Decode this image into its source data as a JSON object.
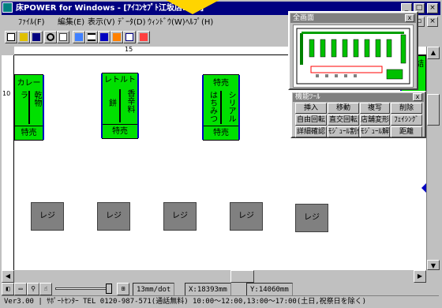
{
  "window": {
    "title": "床POWER for Windows - [ｱｲｺﾝｾﾌﾟﾄ江坂店.FLY]"
  },
  "menu": [
    {
      "label": "ﾌｧｲﾙ(F)"
    },
    {
      "label": "編集(E)"
    },
    {
      "label": "表示(V)"
    },
    {
      "label": "ﾃﾞｰﾀ(D)"
    },
    {
      "label": "ｳｨﾝﾄﾞｳ(W)"
    },
    {
      "label": "ﾍﾙﾌﾟ(H)"
    }
  ],
  "ruler": {
    "top_mark": "15",
    "left_mark": "10"
  },
  "shelves": [
    {
      "top": "カレー",
      "cells": [
        "ラ",
        "乾物"
      ],
      "bottom": "特売"
    },
    {
      "top": "レトルト",
      "cells": [
        "餅",
        "香辛料"
      ],
      "bottom": "特売"
    },
    {
      "top": "特売",
      "cells": [
        "はちみつ",
        "シリアル"
      ],
      "bottom": "特売"
    },
    {
      "top": "缶詰"
    }
  ],
  "registers": [
    {
      "label": "レジ"
    },
    {
      "label": "レジ"
    },
    {
      "label": "レジ"
    },
    {
      "label": "レジ"
    },
    {
      "label": "レジ"
    }
  ],
  "overview": {
    "title": "全画面",
    "close": "x"
  },
  "tools": {
    "title": "機能ﾂｰﾙ",
    "close": "x",
    "buttons": [
      [
        "挿入",
        "移動",
        "複写",
        "削除"
      ],
      [
        "自由回転",
        "直交回転",
        "店舗変形",
        "ﾌｪｲｼﾝｸﾞ"
      ],
      [
        "詳細確認",
        "ﾓｼﾞｭｰﾙ割付",
        "ﾓｼﾞｭｰﾙ解除",
        "距離"
      ]
    ]
  },
  "zoombar": {
    "scale": "13mm/dot",
    "x": "X:18393mm",
    "y": "Y:14060mm"
  },
  "status": {
    "text": "Ver3.00 | ｻﾎﾟｰﾄｾﾝﾀｰ TEL 0120-987-571(通話無料) 10:00～12:00,13:00～17:00(土日,祝祭日を除く)"
  },
  "colors": {
    "titlebar": "#000080",
    "shelf": "#00e000",
    "register": "#808080",
    "callout": "#ffd400"
  }
}
